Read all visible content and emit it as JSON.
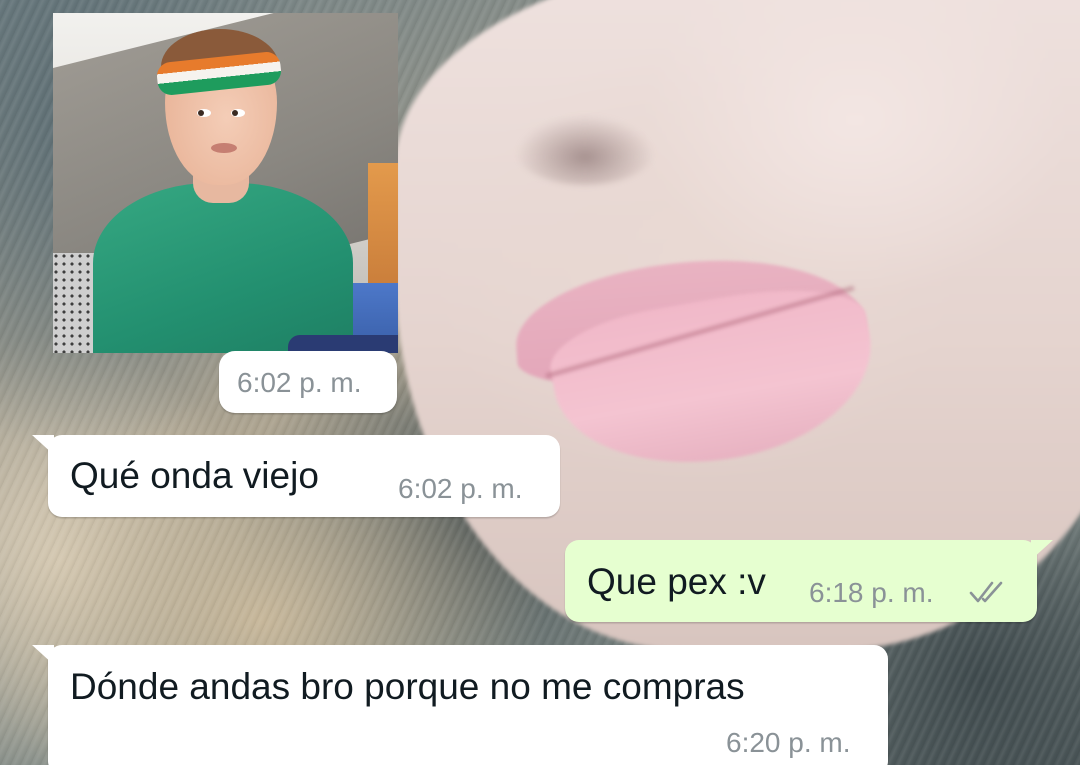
{
  "conversation": {
    "messages": [
      {
        "kind": "sticker",
        "direction": "incoming",
        "sticker": "boy-in-green-shirt-with-headband",
        "time": "6:02 p. m."
      },
      {
        "kind": "text",
        "direction": "incoming",
        "text": "Qué onda viejo",
        "time": "6:02 p. m."
      },
      {
        "kind": "text",
        "direction": "outgoing",
        "text": "Que pex :v",
        "time": "6:18 p. m.",
        "status_icon": "double-check-icon"
      },
      {
        "kind": "text",
        "direction": "incoming",
        "text": "Dónde andas bro porque no me compras",
        "time": "6:20 p. m."
      }
    ]
  },
  "theme": {
    "incoming_bubble": "#ffffff",
    "outgoing_bubble": "#e6ffd0",
    "text_color": "#111b21",
    "time_color": "#8a9297",
    "check_color": "#8a9297",
    "wallpaper": "photo-close-up-lips-and-hair"
  }
}
